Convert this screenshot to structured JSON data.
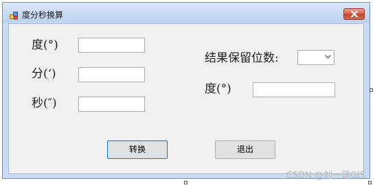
{
  "window": {
    "title": "度分秒换算"
  },
  "left_inputs": [
    {
      "label": "度(°)",
      "value": ""
    },
    {
      "label": "分(‘)",
      "value": ""
    },
    {
      "label": "秒(″)",
      "value": ""
    }
  ],
  "right": {
    "precision_label": "结果保留位数:",
    "precision_selected": "",
    "result_label": "度(°)",
    "result_value": ""
  },
  "buttons": {
    "convert": "转换",
    "exit": "退出"
  },
  "watermark": "CSDN @刘一哥GIS",
  "colors": {
    "accent": "#0078d7",
    "close_button": "#c9503a",
    "form_background": "#f0f0f0"
  }
}
